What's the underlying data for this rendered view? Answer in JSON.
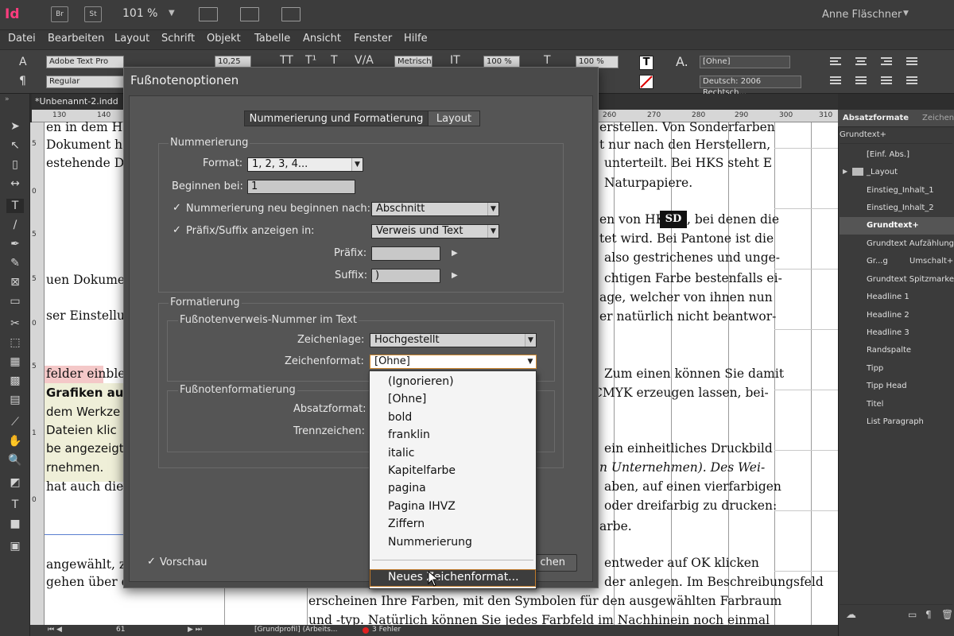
{
  "app": {
    "logo": "Id",
    "buttons": [
      "Br",
      "St"
    ],
    "zoom": "101 %",
    "user": "Anne Fläschner",
    "window_controls": [
      "—",
      "□",
      "✕"
    ]
  },
  "menu": [
    "Datei",
    "Bearbeiten",
    "Layout",
    "Schrift",
    "Objekt",
    "Tabelle",
    "Ansicht",
    "Fenster",
    "Hilfe"
  ],
  "control": {
    "font": "Adobe Text Pro",
    "style": "Regular",
    "size": "10,25 Pt",
    "kerning": "Metrisch",
    "scale_v": "100 %",
    "scale_h": "100 %",
    "char_style": "[Ohne]",
    "language": "Deutsch: 2006 Rechtsch..."
  },
  "document": {
    "tab": "*Unbenannt-2.indd",
    "ruler_h": [
      "130",
      "140",
      "260",
      "270",
      "280",
      "290",
      "300",
      "310"
    ],
    "ruler_v": [
      "5",
      "0",
      "5",
      "5",
      "0",
      "5",
      "1",
      "0"
    ],
    "left_text": [
      "en in dem H",
      "Dokument h",
      "estehende D",
      "uen Dokume",
      "ser Einstellu",
      "felder einble",
      "Grafiken aufg",
      "dem Werkze",
      "Dateien  klic",
      "be angezeigt",
      "rnehmen.",
      "hat auch dies",
      "angewählt, z",
      "gehen über d"
    ],
    "right_text": [
      "erstellen. Von Sonderfarben",
      "t nur nach den Herstellern,",
      "unterteilt. Bei HKS steht E",
      "Naturpapiere.",
      "en von HKS",
      ", bei denen die",
      "tet wird. Bei Pantone ist die",
      "also gestrichenes und unge-",
      "chtigen Farbe bestenfalls ei-",
      "age, welcher von ihnen nun",
      "er natürlich nicht beantwor-",
      "Zum einen können Sie damit",
      "CMYK erzeugen lassen, bei-",
      "ein einheitliches Druckbild",
      "n Unternehmen). Des Wei-",
      "aben, auf einen vierfarbigen",
      "oder dreifarbig zu drucken:",
      "arbe.",
      "entweder auf OK klicken",
      "der anlegen. Im Beschreibungsfeld",
      "erscheinen Ihre Farben, mit den Symbolen für den ausgewählten Farbraum",
      "und -typ. Natürlich können Sie jedes Farbfeld im Nachhinein noch einmal"
    ],
    "hks_badge": "SD"
  },
  "status": {
    "page": "61",
    "profile": "[Grundprofil] (Arbeits...",
    "errors": "3 Fehler"
  },
  "panel": {
    "tabs": [
      "Absatzformate",
      "Zeichen"
    ],
    "current": "Grundtext+",
    "items": [
      "[Einf. Abs.]",
      "_Layout",
      "Einstieg_Inhalt_1",
      "Einstieg_Inhalt_2",
      "Grundtext+",
      "Grundtext Aufzählung",
      "Gr...g",
      "Grundtext Spitzmarke",
      "Headline 1",
      "Headline 2",
      "Headline 3",
      "Randspalte",
      "Tipp",
      "Tipp Head",
      "Titel",
      "List Paragraph"
    ],
    "shortcut": "Umschalt+S"
  },
  "dialog": {
    "title": "Fußnotenoptionen",
    "tabs": [
      "Nummerierung und Formatierung",
      "Layout"
    ],
    "numbering_group": "Nummerierung",
    "format_label": "Format:",
    "format_value": "1, 2, 3, 4...",
    "start_label": "Beginnen bei:",
    "start_value": "1",
    "restart_label": "Nummerierung neu beginnen nach:",
    "restart_value": "Abschnitt",
    "prefix_suffix_label": "Präfix/Suffix anzeigen in:",
    "prefix_suffix_value": "Verweis und Text",
    "prefix_label": "Präfix:",
    "prefix_value": "",
    "suffix_label": "Suffix:",
    "suffix_value": ")",
    "format_group": "Formatierung",
    "ref_group": "Fußnotenverweis-Nummer im Text",
    "position_label": "Zeichenlage:",
    "position_value": "Hochgestellt",
    "charstyle_label": "Zeichenformat:",
    "charstyle_value": "[Ohne]",
    "fn_group": "Fußnotenformatierung",
    "para_label": "Absatzformat:",
    "sep_label": "Trennzeichen:",
    "preview_label": "Vorschau",
    "cancel_label": "Abbrechen",
    "cancel_visible": "chen"
  },
  "dropdown": {
    "options": [
      "(Ignorieren)",
      "[Ohne]",
      "bold",
      "franklin",
      "italic",
      "Kapitelfarbe",
      "pagina",
      "Pagina IHVZ",
      "Ziffern",
      "Nummerierung"
    ],
    "new_item": "Neues Zeichenformat..."
  }
}
